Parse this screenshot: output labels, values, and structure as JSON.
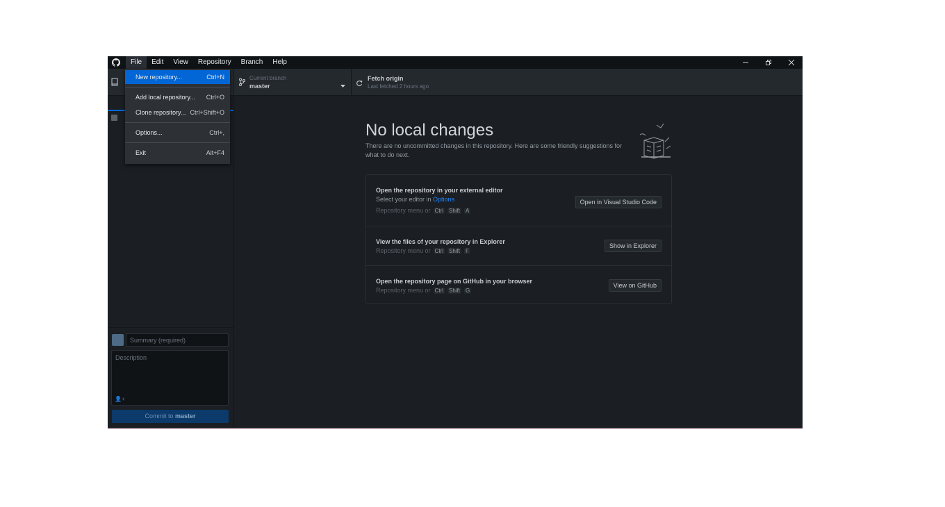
{
  "app": {
    "menu": [
      "File",
      "Edit",
      "View",
      "Repository",
      "Branch",
      "Help"
    ]
  },
  "toolbar": {
    "branch_label": "Current branch",
    "branch_value": "master",
    "fetch_label": "Fetch origin",
    "fetch_sub": "Last fetched 2 hours ago"
  },
  "file_menu": {
    "items": [
      {
        "label": "New repository...",
        "accel": "Ctrl+N"
      },
      {
        "label": "Add local repository...",
        "accel": "Ctrl+O"
      },
      {
        "label": "Clone repository...",
        "accel": "Ctrl+Shift+O"
      },
      {
        "label": "Options...",
        "accel": "Ctrl+,"
      },
      {
        "label": "Exit",
        "accel": "Alt+F4"
      }
    ]
  },
  "sidebar": {
    "summary_placeholder": "Summary (required)",
    "description_placeholder": "Description",
    "commit_prefix": "Commit to ",
    "commit_branch": "master"
  },
  "main": {
    "title": "No local changes",
    "subtitle": "There are no uncommitted changes in this repository. Here are some friendly suggestions for what to do next.",
    "suggestions": [
      {
        "title": "Open the repository in your external editor",
        "line_prefix": "Select your editor in ",
        "line_link": "Options",
        "hint": "Repository menu or",
        "keys": [
          "Ctrl",
          "Shift",
          "A"
        ],
        "button": "Open in Visual Studio Code"
      },
      {
        "title": "View the files of your repository in Explorer",
        "hint": "Repository menu or",
        "keys": [
          "Ctrl",
          "Shift",
          "F"
        ],
        "button": "Show in Explorer"
      },
      {
        "title": "Open the repository page on GitHub in your browser",
        "hint": "Repository menu or",
        "keys": [
          "Ctrl",
          "Shift",
          "G"
        ],
        "button": "View on GitHub"
      }
    ]
  }
}
